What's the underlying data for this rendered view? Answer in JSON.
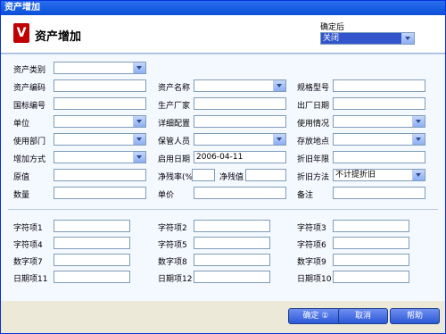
{
  "window": {
    "title": "资产增加"
  },
  "header": {
    "title": "资产增加",
    "logo_glyph": "V"
  },
  "confirm": {
    "label": "确定后",
    "value": "关闭"
  },
  "rows": [
    {
      "label1": "资产类别",
      "field1": "",
      "label2": "",
      "field2": "",
      "label3": "",
      "field3": ""
    },
    {
      "label1": "资产编码",
      "label2": "资产名称",
      "label3": "规格型号"
    },
    {
      "label1": "国标编号",
      "label2": "生产厂家",
      "label3": "出厂日期"
    },
    {
      "label1": "单位",
      "label2": "详细配置",
      "label3": "使用情况"
    },
    {
      "label1": "使用部门",
      "label2": "保管人员",
      "label3": "存放地点"
    },
    {
      "label1": "增加方式",
      "label2": "启用日期",
      "field2": "2006-04-11",
      "label3": "折旧年限"
    },
    {
      "label1": "原值",
      "label2a": "净残率(%)",
      "label2b": "净残值",
      "label3": "折旧方法",
      "field3": "不计提折旧"
    },
    {
      "label1": "数量",
      "label2": "单价",
      "label3": "备注"
    }
  ],
  "custom": [
    {
      "c1": "字符项1",
      "c2": "字符项2",
      "c3": "字符项3"
    },
    {
      "c1": "字符项4",
      "c2": "字符项5",
      "c3": "字符项6"
    },
    {
      "c1": "数字项7",
      "c2": "数字项8",
      "c3": "数字项9"
    },
    {
      "c1": "日期项11",
      "c2": "日期项12",
      "c3": "日期项10"
    }
  ],
  "buttons": {
    "ok": "确定 ①",
    "cancel": "取消",
    "help": "帮助"
  }
}
